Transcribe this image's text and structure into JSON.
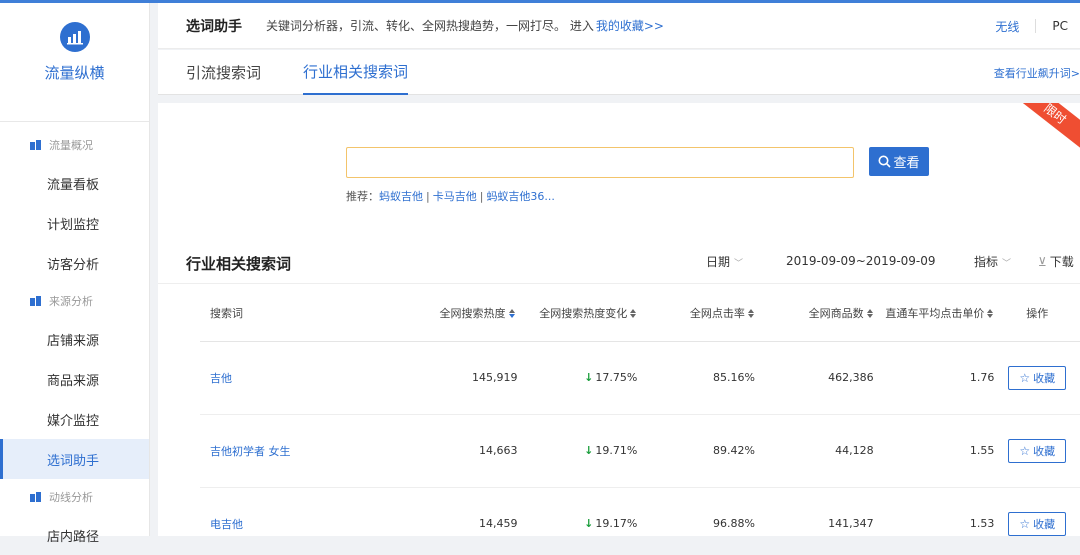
{
  "brand": {
    "name": "流量纵横"
  },
  "sidebar": {
    "groups": [
      {
        "label": "流量概况",
        "items": [
          "流量看板",
          "计划监控",
          "访客分析"
        ]
      },
      {
        "label": "来源分析",
        "items": [
          "店铺来源",
          "商品来源",
          "媒介监控",
          "选词助手"
        ]
      },
      {
        "label": "动线分析",
        "items": [
          "店内路径"
        ]
      }
    ],
    "active_item": "选词助手"
  },
  "header": {
    "title": "选词助手",
    "desc": "关键词分析器，引流、转化、全网热搜趋势，一网打尽。 进入",
    "link": "我的收藏>>",
    "wireless": "无线",
    "pc": "PC"
  },
  "tabs": {
    "items": [
      "引流搜索词",
      "行业相关搜索词"
    ],
    "active": "行业相关搜索词",
    "right_link": "查看行业飙升词>"
  },
  "ribbon": "限时",
  "search": {
    "value": "",
    "button": "查看",
    "recommend_label": "推荐：",
    "recommend": [
      "蚂蚁吉他",
      "卡马吉他",
      "蚂蚁吉他36..."
    ]
  },
  "section": {
    "title": "行业相关搜索词",
    "date_label": "日期",
    "date_range": "2019-09-09~2019-09-09",
    "metric_label": "指标",
    "download_label": "下载"
  },
  "table": {
    "headers": [
      "搜索词",
      "全网搜索热度",
      "全网搜索热度变化",
      "全网点击率",
      "全网商品数",
      "直通车平均点击单价",
      "操作"
    ],
    "rows": [
      {
        "keyword": "吉他",
        "heat": "145,919",
        "change": "17.75%",
        "ctr": "85.16%",
        "goods": "462,386",
        "cpc": "1.76",
        "action": "收藏"
      },
      {
        "keyword": "吉他初学者 女生",
        "heat": "14,663",
        "change": "19.71%",
        "ctr": "89.42%",
        "goods": "44,128",
        "cpc": "1.55",
        "action": "收藏"
      },
      {
        "keyword": "电吉他",
        "heat": "14,459",
        "change": "19.17%",
        "ctr": "96.88%",
        "goods": "141,347",
        "cpc": "1.53",
        "action": "收藏"
      }
    ]
  },
  "colors": {
    "accent": "#2e6fd0",
    "decrease": "#1a9e3c",
    "ribbon": "#ef4e32"
  }
}
